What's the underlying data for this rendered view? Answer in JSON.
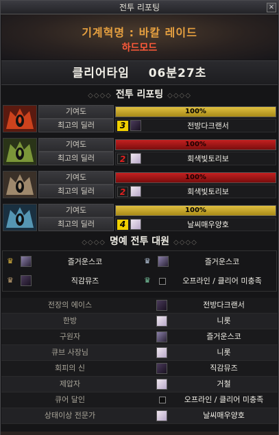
{
  "window": {
    "title": "전투 리포팅",
    "close_label": "×"
  },
  "raid": {
    "title": "기계혁명 : 바칼 레이드",
    "difficulty": "하드모드"
  },
  "clear": {
    "label": "클리어타임",
    "time": "06분27초"
  },
  "report": {
    "section_title": "전투 리포팅",
    "contribution_label": "기여도",
    "top_dealer_label": "최고의 딜러",
    "parties": [
      {
        "icon": "red-demon-party-icon",
        "bar_color": "#d4b428",
        "contribution_text": "100%",
        "contribution_value": 100,
        "rank": "3",
        "dealer": "전방다크랜서",
        "avatar": "dark"
      },
      {
        "icon": "green-demon-party-icon",
        "bar_color": "#b01818",
        "contribution_text": "100%",
        "contribution_value": 100,
        "rank": "2",
        "dealer": "회색빛토리보",
        "avatar": "light"
      },
      {
        "icon": "gray-demon-party-icon",
        "bar_color": "#b01818",
        "contribution_text": "100%",
        "contribution_value": 100,
        "rank": "2",
        "dealer": "회색빛토리보",
        "avatar": "light"
      },
      {
        "icon": "blue-demon-party-icon",
        "bar_color": "#d4b428",
        "contribution_text": "100%",
        "contribution_value": 100,
        "rank": "4",
        "dealer": "날씨매우양호",
        "avatar": "light"
      }
    ]
  },
  "honor": {
    "section_title": "명예 전투 대원",
    "members": [
      {
        "name": "즐거운스코",
        "crown": "gold-crown-icon"
      },
      {
        "name": "즐거운스코",
        "crown": "silver-crown-icon"
      },
      {
        "name": "직감뮤즈",
        "crown": "bronze-crown-icon"
      },
      {
        "name": "오프라인 / 클리어 미충족",
        "crown": "teal-crown-icon"
      }
    ]
  },
  "awards": [
    {
      "label": "전장의 에이스",
      "name": "전방다크랜서"
    },
    {
      "label": "한방",
      "name": "니롯"
    },
    {
      "label": "구원자",
      "name": "즐거운스코"
    },
    {
      "label": "큐브 사장님",
      "name": "니롯"
    },
    {
      "label": "회피의 신",
      "name": "직감뮤즈"
    },
    {
      "label": "제압자",
      "name": "거철"
    },
    {
      "label": "큐어 달인",
      "name": "오프라인 / 클리어 미충족"
    },
    {
      "label": "상태이상 전문가",
      "name": "날씨매우양호"
    }
  ],
  "colors": {
    "accent_gold": "#e6a040",
    "hard_mode": "#ff5a3a",
    "bar_gold": "#d4b428",
    "bar_red": "#b01818"
  }
}
